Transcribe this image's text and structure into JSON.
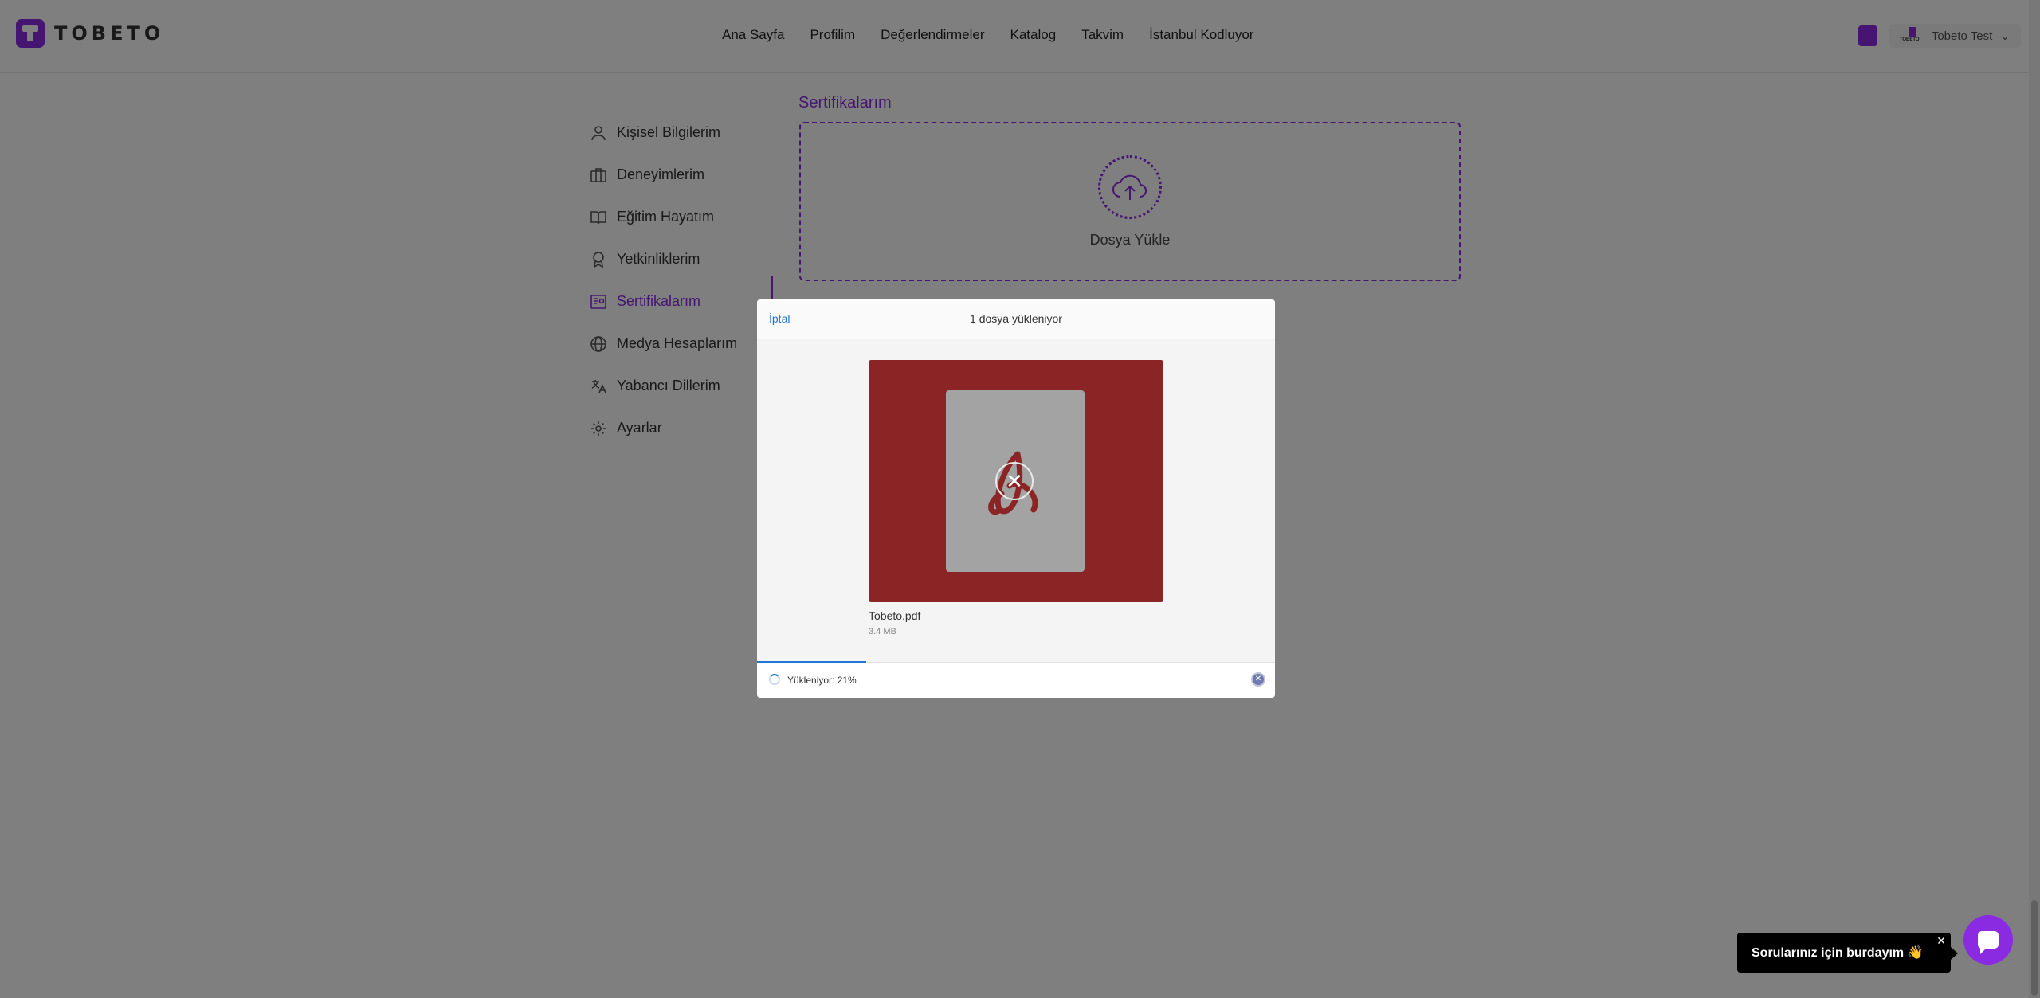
{
  "header": {
    "logo_text": "TOBETO",
    "nav": [
      "Ana Sayfa",
      "Profilim",
      "Değerlendirmeler",
      "Katalog",
      "Takvim",
      "İstanbul Kodluyor"
    ],
    "user_name": "Tobeto Test",
    "mini_logo_text": "TOBETO"
  },
  "sidebar": {
    "items": [
      {
        "label": "Kişisel Bilgilerim",
        "icon": "user-icon"
      },
      {
        "label": "Deneyimlerim",
        "icon": "briefcase-icon"
      },
      {
        "label": "Eğitim Hayatım",
        "icon": "book-icon"
      },
      {
        "label": "Yetkinliklerim",
        "icon": "award-icon"
      },
      {
        "label": "Sertifikalarım",
        "icon": "certificate-icon"
      },
      {
        "label": "Medya Hesaplarım",
        "icon": "globe-icon"
      },
      {
        "label": "Yabancı Dillerim",
        "icon": "language-icon"
      },
      {
        "label": "Ayarlar",
        "icon": "gear-icon"
      }
    ],
    "active_index": 4
  },
  "main": {
    "section_title": "Sertifikalarım",
    "dropzone_label": "Dosya Yükle"
  },
  "modal": {
    "cancel_label": "İptal",
    "title": "1 dosya yükleniyor",
    "file_name": "Tobeto.pdf",
    "file_size": "3.4 MB",
    "status": "Yükleniyor: 21%",
    "progress_percent": 21,
    "remove_glyph": "✕"
  },
  "chat": {
    "tooltip": "Sorularınız için burdayım 👋",
    "close_glyph": "✕"
  },
  "colors": {
    "accent": "#8a2be2",
    "link": "#2275d7",
    "pdf_bg": "#8b2525"
  }
}
